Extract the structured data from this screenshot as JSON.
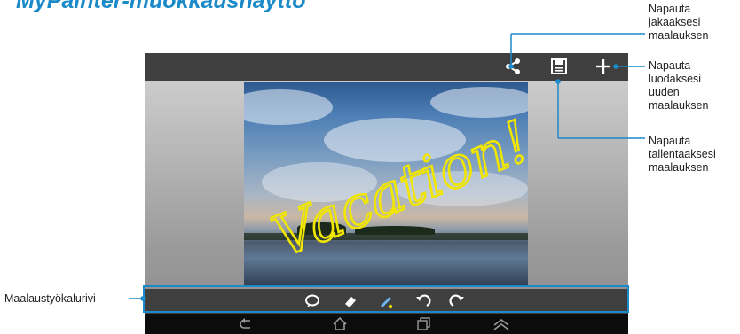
{
  "heading": "MyPainter-muokkausnäyttö",
  "topbar": {
    "icons": [
      "share-icon",
      "save-icon",
      "plus-icon"
    ]
  },
  "canvas": {
    "scribble_text": "Vacation!",
    "ink_color": "#f1e600"
  },
  "toolbar": {
    "icons": [
      "speech-bubble-icon",
      "eraser-icon",
      "pen-icon",
      "undo-icon",
      "redo-icon"
    ]
  },
  "navbar": {
    "icons": [
      "back-icon",
      "home-icon",
      "recent-apps-icon",
      "menu-icon"
    ]
  },
  "callouts": {
    "share": "Napauta\njakaaksesi\nmaalauksen",
    "new": "Napauta\nluodaksesi\nuuden\nmaalauksen",
    "save": "Napauta\ntallentaaksesi\nmaalauksen",
    "toolbar": "Maalaustyökalurivi"
  },
  "accent_color": "#1a8ac9"
}
